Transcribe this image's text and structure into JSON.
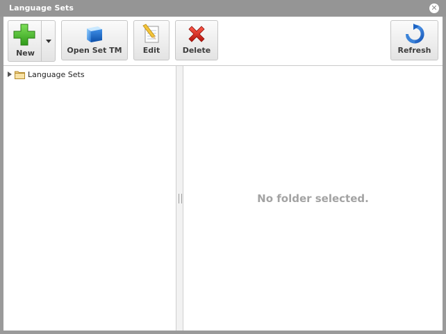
{
  "window": {
    "title": "Language Sets",
    "close_icon": "close-icon"
  },
  "toolbar": {
    "new_label": "New",
    "open_set_tm_label": "Open Set TM",
    "edit_label": "Edit",
    "delete_label": "Delete",
    "refresh_label": "Refresh"
  },
  "tree": {
    "root_label": "Language Sets",
    "root_icon": "folder-icon"
  },
  "details": {
    "empty_message": "No folder selected."
  },
  "colors": {
    "titlebar": "#959595",
    "frame": "#9a9a9a",
    "empty_text": "#a3a3a3"
  }
}
